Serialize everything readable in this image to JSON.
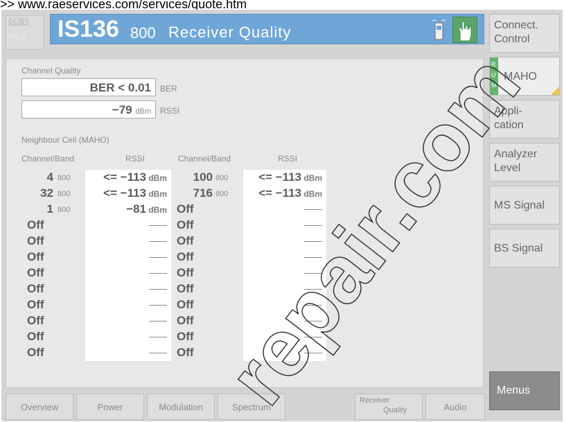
{
  "url_line": ">> www.raeservices.com/services/quote.htm",
  "header": {
    "ch1": "Ch. 1",
    "ch2": "Ch. 2",
    "title_main": "IS136",
    "title_band": "800",
    "title_text": "Receiver Quality"
  },
  "channel_quality": {
    "label": "Channel Quality",
    "ber_value": "BER < 0.01",
    "ber_unit": "BER",
    "rssi_value": "−79",
    "rssi_unit_small": "dBm",
    "rssi_label": "RSSI"
  },
  "neighbour": {
    "label": "Neighbour Cell (MAHO)",
    "headers": [
      "Channel/Band",
      "RSSI",
      "Channel/Band",
      "RSSI"
    ],
    "rows": [
      {
        "ch1": "4",
        "band1": "800",
        "rssi1": "<= −113",
        "unit1": "dBm",
        "ch2": "100",
        "band2": "800",
        "rssi2": "<= −113",
        "unit2": "dBm"
      },
      {
        "ch1": "32",
        "band1": "800",
        "rssi1": "<= −113",
        "unit1": "dBm",
        "ch2": "716",
        "band2": "800",
        "rssi2": "<= −113",
        "unit2": "dBm"
      },
      {
        "ch1": "1",
        "band1": "800",
        "rssi1": "−81",
        "unit1": "dBm",
        "ch2": "Off",
        "band2": "",
        "rssi2": "",
        "unit2": ""
      },
      {
        "ch1": "Off",
        "band1": "",
        "rssi1": "",
        "unit1": "",
        "ch2": "Off",
        "band2": "",
        "rssi2": "",
        "unit2": ""
      },
      {
        "ch1": "Off",
        "band1": "",
        "rssi1": "",
        "unit1": "",
        "ch2": "Off",
        "band2": "",
        "rssi2": "",
        "unit2": ""
      },
      {
        "ch1": "Off",
        "band1": "",
        "rssi1": "",
        "unit1": "",
        "ch2": "Off",
        "band2": "",
        "rssi2": "",
        "unit2": ""
      },
      {
        "ch1": "Off",
        "band1": "",
        "rssi1": "",
        "unit1": "",
        "ch2": "Off",
        "band2": "",
        "rssi2": "",
        "unit2": ""
      },
      {
        "ch1": "Off",
        "band1": "",
        "rssi1": "",
        "unit1": "",
        "ch2": "Off",
        "band2": "",
        "rssi2": "",
        "unit2": ""
      },
      {
        "ch1": "Off",
        "band1": "",
        "rssi1": "",
        "unit1": "",
        "ch2": "Off",
        "band2": "",
        "rssi2": "",
        "unit2": ""
      },
      {
        "ch1": "Off",
        "band1": "",
        "rssi1": "",
        "unit1": "",
        "ch2": "Off",
        "band2": "",
        "rssi2": "",
        "unit2": ""
      },
      {
        "ch1": "Off",
        "band1": "",
        "rssi1": "",
        "unit1": "",
        "ch2": "Off",
        "band2": "",
        "rssi2": "",
        "unit2": ""
      },
      {
        "ch1": "Off",
        "band1": "",
        "rssi1": "",
        "unit1": "",
        "ch2": "Off",
        "band2": "",
        "rssi2": "",
        "unit2": ""
      }
    ]
  },
  "softkeys": {
    "connect_control": [
      "Connect.",
      "Control"
    ],
    "maho": "MAHO",
    "rum": [
      "R",
      "U",
      "M"
    ],
    "application": [
      "Appli-",
      "cation"
    ],
    "analyzer_level": [
      "Analyzer",
      "Level"
    ],
    "ms_signal": "MS Signal",
    "bs_signal": "BS Signal",
    "menus": "Menus"
  },
  "tabs": {
    "overview": "Overview",
    "power": "Power",
    "modulation": "Modulation",
    "spectrum": "Spectrum",
    "receiver_quality_1": "Receiver",
    "receiver_quality_2": "Quality",
    "audio": "Audio"
  },
  "colors": {
    "title_bar": "#6fa6d8",
    "rum_strip": "#66b36f",
    "menus_button": "#8c8c8c"
  },
  "watermark": "repair.com"
}
